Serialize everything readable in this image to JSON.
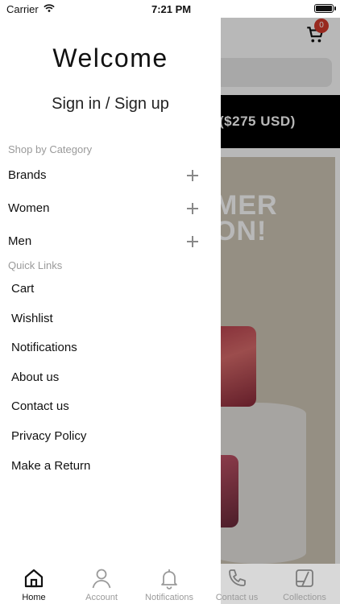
{
  "status_bar": {
    "carrier": "Carrier",
    "time": "7:21 PM"
  },
  "background": {
    "cart_count": "0",
    "banner_text": "D ($275 USD)",
    "hero_text_line1": "MER",
    "hero_text_line2": "ON!"
  },
  "drawer": {
    "welcome": "Welcome",
    "signin": "Sign in / Sign up",
    "category_heading": "Shop by Category",
    "categories": [
      {
        "label": "Brands"
      },
      {
        "label": "Women"
      },
      {
        "label": "Men"
      }
    ],
    "quick_links_heading": "Quick Links",
    "links": [
      {
        "label": "Cart"
      },
      {
        "label": "Wishlist"
      },
      {
        "label": "Notifications"
      },
      {
        "label": "About us"
      },
      {
        "label": "Contact us"
      },
      {
        "label": "Privacy Policy"
      },
      {
        "label": "Make a Return"
      }
    ]
  },
  "tabbar": {
    "tabs": [
      {
        "label": "Home",
        "icon": "home-icon",
        "active": true
      },
      {
        "label": "Account",
        "icon": "person-icon"
      },
      {
        "label": "Notifications",
        "icon": "bell-icon"
      },
      {
        "label": "Contact us",
        "icon": "phone-icon"
      },
      {
        "label": "Collections",
        "icon": "collections-icon"
      }
    ]
  },
  "colors": {
    "badge": "#d33a2c",
    "dim_overlay": "rgba(0,0,0,0.28)"
  }
}
